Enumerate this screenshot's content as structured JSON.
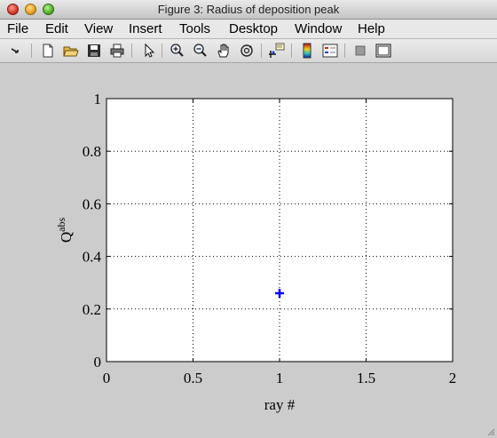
{
  "window": {
    "title": "Figure 3: Radius of deposition peak"
  },
  "menu": {
    "items": [
      "File",
      "Edit",
      "View",
      "Insert",
      "Tools",
      "Desktop",
      "Window",
      "Help"
    ]
  },
  "toolbar": {
    "buttons": [
      "dock-arrow-icon",
      "new-file-icon",
      "open-folder-icon",
      "save-icon",
      "print-icon",
      "pointer-icon",
      "zoom-in-icon",
      "zoom-out-icon",
      "pan-hand-icon",
      "rotate-3d-icon",
      "data-cursor-icon",
      "colorbar-icon",
      "legend-icon",
      "hide-plot-tools-icon",
      "show-plot-tools-icon"
    ]
  },
  "chart_data": {
    "type": "scatter",
    "title": "",
    "xlabel": "ray #",
    "ylabel_base": "Q",
    "ylabel_superscript": "abs",
    "xlim": [
      0,
      2
    ],
    "ylim": [
      0,
      1
    ],
    "xticks": [
      "0",
      "0.5",
      "1",
      "1.5",
      "2"
    ],
    "yticks": [
      "0",
      "0.2",
      "0.4",
      "0.6",
      "0.8",
      "1"
    ],
    "xtick_values": [
      0,
      0.5,
      1,
      1.5,
      2
    ],
    "ytick_values": [
      0,
      0.2,
      0.4,
      0.6,
      0.8,
      1
    ],
    "grid": true,
    "grid_style": "dotted",
    "series": [
      {
        "marker": "+",
        "color": "#0000ff",
        "points": [
          {
            "x": 1,
            "y": 0.26
          }
        ]
      }
    ]
  }
}
